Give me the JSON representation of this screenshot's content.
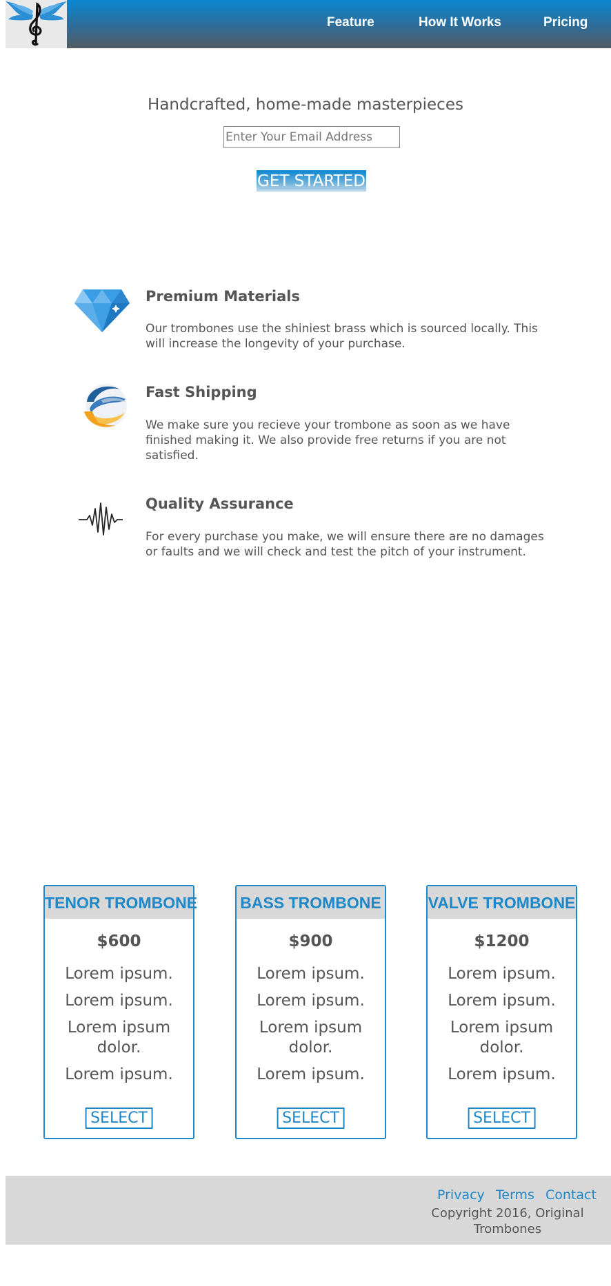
{
  "header": {
    "logo_alt": "treble-clef-wings-logo",
    "nav": [
      {
        "label": "Feature"
      },
      {
        "label": "How It Works"
      },
      {
        "label": "Pricing"
      }
    ]
  },
  "hero": {
    "title": "Handcrafted, home-made masterpieces",
    "email_placeholder": "Enter Your Email Address",
    "cta_label": "GET STARTED"
  },
  "features": [
    {
      "icon": "diamond-icon",
      "title": "Premium Materials",
      "description": "Our trombones use the shiniest brass which is sourced locally. This will increase the longevity of your purchase."
    },
    {
      "icon": "globe-icon",
      "title": "Fast Shipping",
      "description": "We make sure you recieve your trombone as soon as we have finished making it. We also provide free returns if you are not satisfied."
    },
    {
      "icon": "soundwave-icon",
      "title": "Quality Assurance",
      "description": "For every purchase you make, we will ensure there are no damages or faults and we will check and test the pitch of your instrument."
    }
  ],
  "pricing": [
    {
      "name": "TENOR TROMBONE",
      "price": "$600",
      "features": [
        "Lorem ipsum.",
        "Lorem ipsum.",
        "Lorem ipsum dolor.",
        "Lorem ipsum."
      ],
      "select_label": "SELECT"
    },
    {
      "name": "BASS TROMBONE",
      "price": "$900",
      "features": [
        "Lorem ipsum.",
        "Lorem ipsum.",
        "Lorem ipsum dolor.",
        "Lorem ipsum."
      ],
      "select_label": "SELECT"
    },
    {
      "name": "VALVE TROMBONE",
      "price": "$1200",
      "features": [
        "Lorem ipsum.",
        "Lorem ipsum.",
        "Lorem ipsum dolor.",
        "Lorem ipsum."
      ],
      "select_label": "SELECT"
    }
  ],
  "footer": {
    "links": [
      {
        "label": "Privacy"
      },
      {
        "label": "Terms"
      },
      {
        "label": "Contact"
      }
    ],
    "copyright": "Copyright 2016, Original Trombones"
  },
  "colors": {
    "accent": "#1e87c8",
    "header_top": "#0a86d0",
    "header_bottom": "#555d63",
    "text": "#555555",
    "footer_bg": "#d8d8d8"
  }
}
